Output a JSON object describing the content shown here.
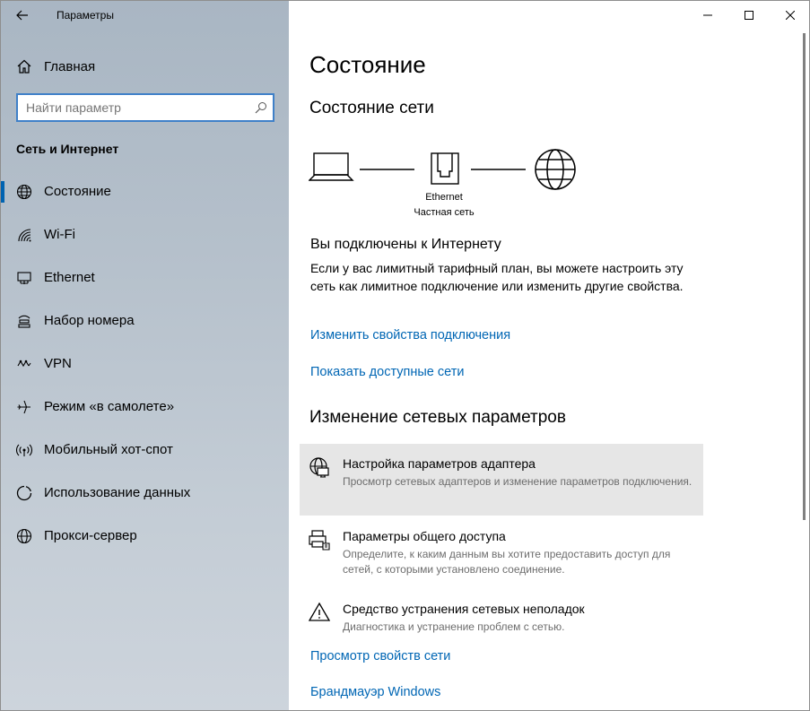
{
  "app": {
    "title": "Параметры"
  },
  "sidebar": {
    "home_label": "Главная",
    "search_placeholder": "Найти параметр",
    "section_title": "Сеть и Интернет",
    "items": [
      {
        "label": "Состояние",
        "icon": "globe-icon",
        "selected": true
      },
      {
        "label": "Wi-Fi",
        "icon": "wifi-icon",
        "selected": false
      },
      {
        "label": "Ethernet",
        "icon": "ethernet-icon",
        "selected": false
      },
      {
        "label": "Набор номера",
        "icon": "dialup-icon",
        "selected": false
      },
      {
        "label": "VPN",
        "icon": "vpn-icon",
        "selected": false
      },
      {
        "label": "Режим «в самолете»",
        "icon": "airplane-icon",
        "selected": false
      },
      {
        "label": "Мобильный хот-спот",
        "icon": "hotspot-icon",
        "selected": false
      },
      {
        "label": "Использование данных",
        "icon": "data-usage-icon",
        "selected": false
      },
      {
        "label": "Прокси-сервер",
        "icon": "proxy-globe-icon",
        "selected": false
      }
    ]
  },
  "main": {
    "page_title": "Состояние",
    "network_status_heading": "Состояние сети",
    "diagram": {
      "adapter_name": "Ethernet",
      "network_type": "Частная сеть"
    },
    "connected_title": "Вы подключены к Интернету",
    "connected_desc": "Если у вас лимитный тарифный план, вы можете настроить эту сеть как лимитное подключение или изменить другие свойства.",
    "link_change_props": "Изменить свойства подключения",
    "link_show_networks": "Показать доступные сети",
    "change_heading": "Изменение сетевых параметров",
    "options": [
      {
        "title": "Настройка параметров адаптера",
        "subtitle": "Просмотр сетевых адаптеров и изменение параметров подключения.",
        "icon": "adapter-settings-icon"
      },
      {
        "title": "Параметры общего доступа",
        "subtitle": "Определите, к каким данным вы хотите предоставить доступ для сетей, с которыми установлено соединение.",
        "icon": "sharing-options-icon"
      },
      {
        "title": "Средство устранения сетевых неполадок",
        "subtitle": "Диагностика и устранение проблем с сетью.",
        "icon": "warning-icon"
      }
    ],
    "link_view_props": "Просмотр свойств сети",
    "link_firewall": "Брандмауэр Windows"
  },
  "colors": {
    "accent": "#0063b1",
    "link": "#0066b4",
    "hover_row": "#e6e6e6",
    "search_border": "#3f80c8"
  }
}
